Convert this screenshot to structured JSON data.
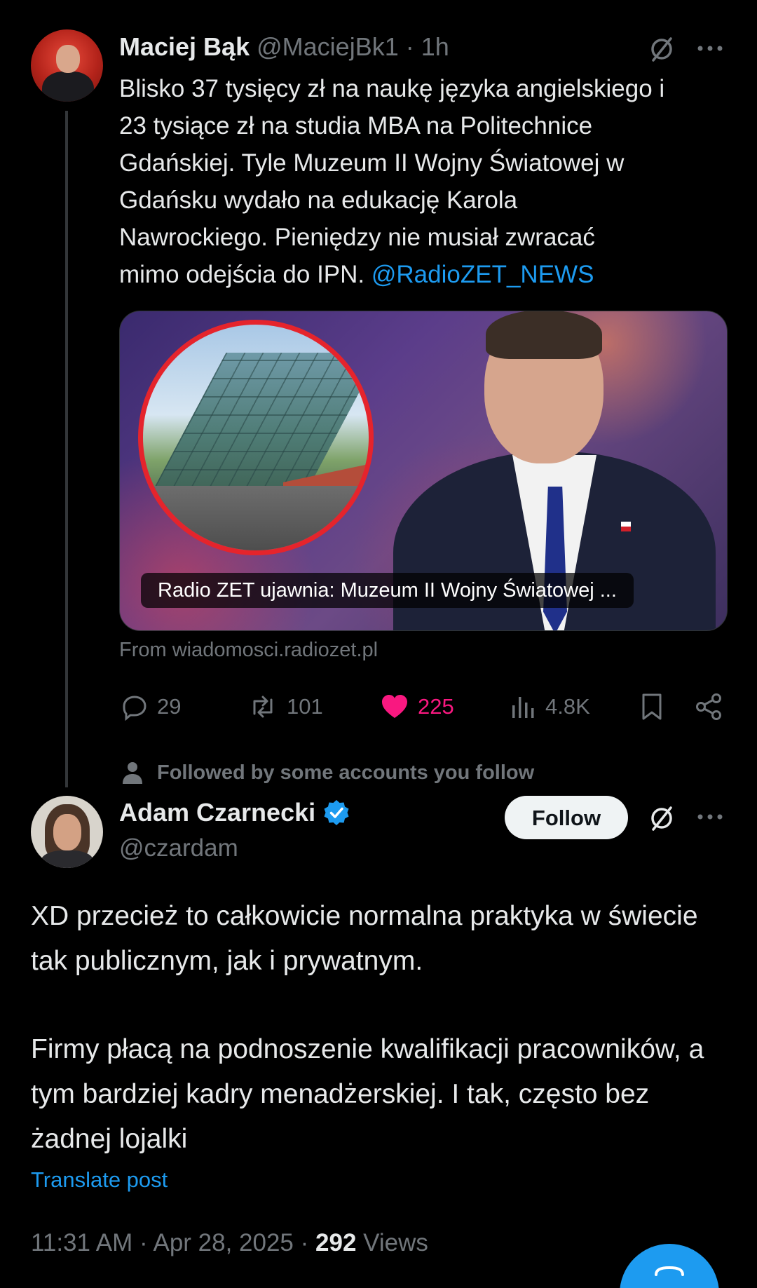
{
  "parent_tweet": {
    "author_name": "Maciej Bąk",
    "handle": "@MaciejBk1",
    "separator": "·",
    "time": "1h",
    "text_lines": [
      "Blisko 37 tysięcy zł na naukę języka angielskiego i",
      "23 tysiące zł na studia MBA na Politechnice",
      "Gdańskiej. Tyle Muzeum II Wojny Światowej w",
      "Gdańsku wydało na edukację Karola",
      "Nawrockiego. Pieniędzy nie musiał zwracać",
      "mimo odejścia do IPN. "
    ],
    "mention": "@RadioZET_NEWS",
    "card_caption": "Radio ZET ujawnia: Muzeum II Wojny Światowej ...",
    "card_source": "From wiadomosci.radiozet.pl",
    "stats": {
      "replies": "29",
      "reposts": "101",
      "likes": "225",
      "views": "4.8K"
    },
    "icons": [
      "grok-icon",
      "more-icon",
      "reply-icon",
      "repost-icon",
      "heart-icon",
      "views-icon",
      "bookmark-icon",
      "share-icon"
    ]
  },
  "followed_by": "Followed by some accounts you follow",
  "main_tweet": {
    "author_name": "Adam Czarnecki",
    "handle": "@czardam",
    "follow_label": "Follow",
    "paragraphs": [
      "XD przecież to całkowicie normalna praktyka w świecie tak publicznym, jak i prywatnym.",
      "Firmy płacą na podnoszenie kwalifikacji pracowników, a tym bardziej kadry menadżerskiej. I tak, często bez żadnej lojalki"
    ],
    "translate_label": "Translate post",
    "time": "11:31 AM",
    "date": "Apr 28, 2025",
    "separator": "·",
    "views_count": "292",
    "views_label": "Views"
  },
  "colors": {
    "background": "#000000",
    "text": "#e7e9ea",
    "muted": "#71767b",
    "accent": "#1d9bf0",
    "like": "#f91880",
    "verified": "#1d9bf0"
  }
}
